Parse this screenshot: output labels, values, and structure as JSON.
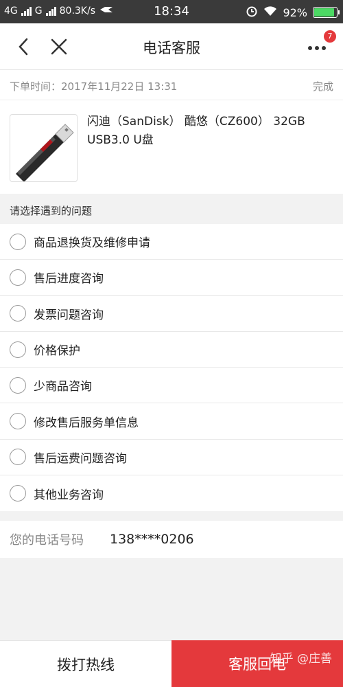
{
  "status_bar": {
    "net1": "4G",
    "net2": "G",
    "speed": "80.3K/s",
    "time": "18:34",
    "battery": "92%",
    "battery_level": 0.92
  },
  "nav": {
    "title": "电话客服",
    "badge_count": "7"
  },
  "order": {
    "time_label": "下单时间：2017年11月22日 13:31",
    "status": "完成",
    "product_name": "闪迪（SanDisk） 酷悠（CZ600） 32GB USB3.0 U盘"
  },
  "questions": {
    "heading": "请选择遇到的问题",
    "items": [
      "商品退换货及维修申请",
      "售后进度咨询",
      "发票问题咨询",
      "价格保护",
      "少商品咨询",
      "修改售后服务单信息",
      "售后运费问题咨询",
      "其他业务咨询"
    ]
  },
  "phone": {
    "label": "您的电话号码",
    "value": "138****0206"
  },
  "footer": {
    "hotline_label": "拨打热线",
    "callback_label": "客服回电",
    "watermark": "知乎 @庄善"
  },
  "colors": {
    "accent": "#e4393c",
    "status_bar": "#3a3a3a"
  }
}
